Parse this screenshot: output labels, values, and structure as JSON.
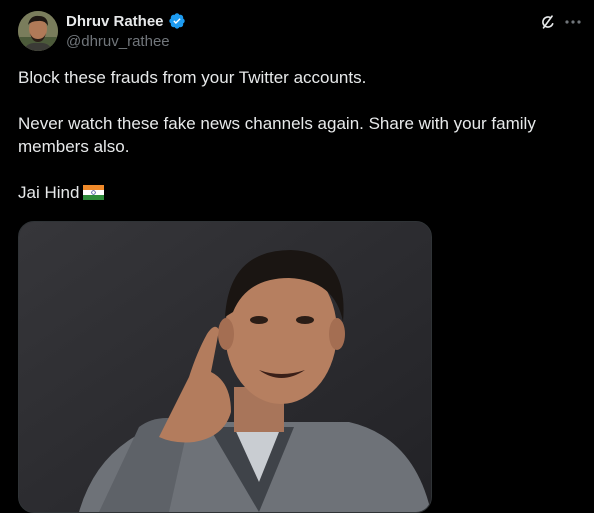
{
  "author": {
    "display_name": "Dhruv Rathee",
    "handle": "@dhruv_rathee",
    "verified": true
  },
  "tweet": {
    "paragraphs": [
      "Block these frauds from your Twitter accounts.",
      "Never watch these fake news channels again. Share with your family members also.",
      "Jai Hind"
    ],
    "emoji": "india-flag"
  },
  "icons": {
    "verified": "verified-badge-icon",
    "grok": "grok-icon",
    "more": "more-options-icon"
  },
  "colors": {
    "background": "#000000",
    "text": "#e7e9ea",
    "secondary": "#71767b",
    "verified": "#1d9bf0",
    "media_border": "#2f3336"
  }
}
